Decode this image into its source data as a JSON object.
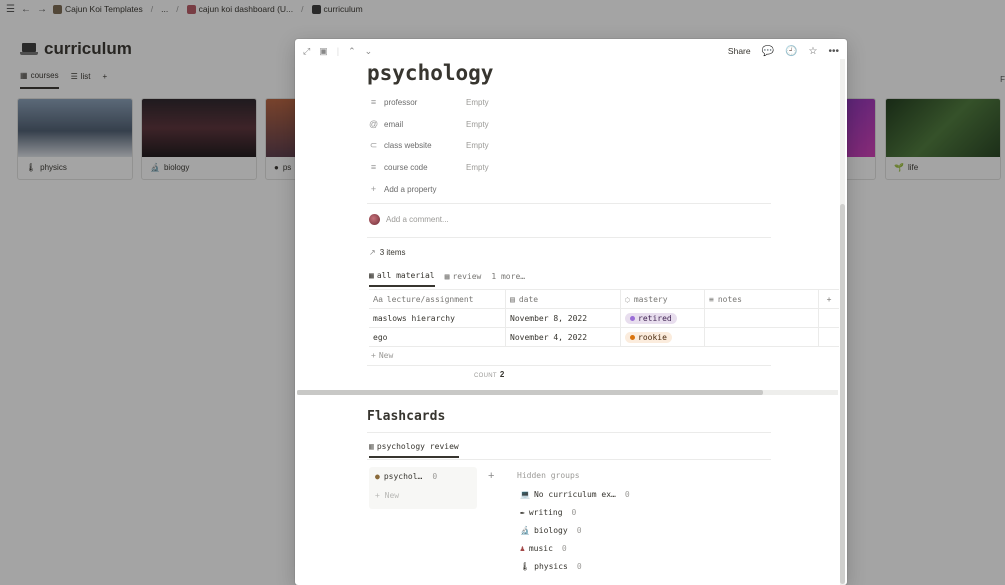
{
  "topbar": {
    "crumbs": [
      "Cajun Koi Templates",
      "...",
      "cajun koi dashboard (U...",
      "curriculum"
    ]
  },
  "page": {
    "title": "curriculum",
    "views": [
      "courses",
      "list"
    ],
    "right_cut_label": "F"
  },
  "gallery": [
    {
      "label": "physics",
      "cover": "#5d6c80"
    },
    {
      "label": "biology",
      "cover": "#3b2a2e"
    },
    {
      "label": "ps",
      "cover": "#a85a3b"
    },
    {
      "label": "",
      "cover": "#7a3bbf"
    },
    {
      "label": "life",
      "cover": "#2f5a2c"
    }
  ],
  "modal": {
    "toolbar": {
      "share": "Share"
    },
    "title": "psychology",
    "properties": [
      {
        "name": "professor",
        "value": "Empty",
        "icon": "text-lines-icon"
      },
      {
        "name": "email",
        "value": "Empty",
        "icon": "at-icon"
      },
      {
        "name": "class website",
        "value": "Empty",
        "icon": "link-icon"
      },
      {
        "name": "course code",
        "value": "Empty",
        "icon": "text-lines-icon"
      }
    ],
    "add_property": "Add a property",
    "comment_placeholder": "Add a comment...",
    "relation_count": "3 items",
    "db_tabs": [
      "all material",
      "review",
      "1 more…"
    ],
    "table": {
      "headers": [
        "lecture/assignment",
        "date",
        "mastery",
        "notes"
      ],
      "rows": [
        {
          "title": "maslows hierarchy",
          "date": "November 8, 2022",
          "mastery": "retired",
          "mastery_bg": "#e8deee",
          "mastery_dot": "#9a6dd7"
        },
        {
          "title": "ego",
          "date": "November 4, 2022",
          "mastery": "rookie",
          "mastery_bg": "#fbecdd",
          "mastery_dot": "#d9730d"
        }
      ],
      "new_label": "New",
      "count_label": "COUNT",
      "count_value": "2"
    },
    "flashcards": {
      "heading": "Flashcards",
      "tab": "psychology review",
      "column": {
        "label": "psychol…",
        "count": "0",
        "new_label": "New"
      },
      "hidden_title": "Hidden groups",
      "hidden_groups": [
        {
          "label": "No curriculum ex…",
          "count": "0",
          "icon": "laptop-icon"
        },
        {
          "label": "writing",
          "count": "0",
          "icon": "quill-icon"
        },
        {
          "label": "biology",
          "count": "0",
          "icon": "microscope-icon"
        },
        {
          "label": "music",
          "count": "0",
          "icon": "person-icon"
        },
        {
          "label": "physics",
          "count": "0",
          "icon": "thermometer-icon"
        }
      ]
    }
  }
}
